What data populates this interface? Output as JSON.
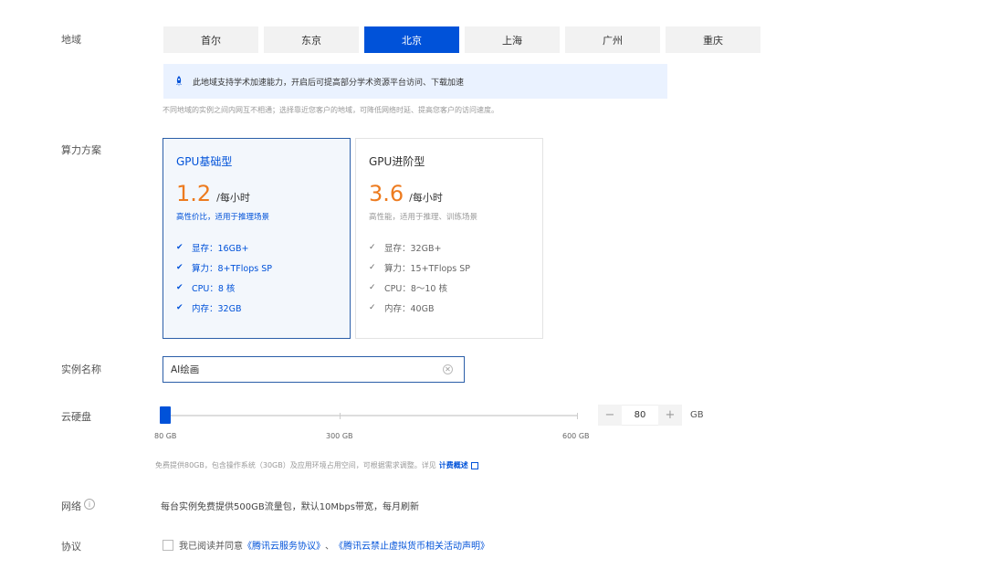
{
  "labels": {
    "region": "地域",
    "plan": "算力方案",
    "instance_name": "实例名称",
    "disk": "云硬盘",
    "network": "网络",
    "agreement": "协议"
  },
  "regions": [
    "首尔",
    "东京",
    "北京",
    "上海",
    "广州",
    "重庆"
  ],
  "selected_region": "北京",
  "notice": {
    "icon": "rocket-icon",
    "text": "此地域支持学术加速能力，开启后可提高部分学术资源平台访问、下载加速"
  },
  "region_hint": "不同地域的实例之间内网互不相通；选择靠近您客户的地域，可降低网络时延、提高您客户的访问速度。",
  "plans": [
    {
      "name": "GPU基础型",
      "price": "1.2",
      "unit": "/每小时",
      "desc": "高性价比，适用于推理场景",
      "specs": [
        "显存：16GB+",
        "算力：8+TFlops SP",
        "CPU：8 核",
        "内存：32GB"
      ],
      "selected": true
    },
    {
      "name": "GPU进阶型",
      "price": "3.6",
      "unit": "/每小时",
      "desc": "高性能，适用于推理、训练场景",
      "specs": [
        "显存：32GB+",
        "算力：15+TFlops SP",
        "CPU：8～10 核",
        "内存：40GB"
      ],
      "selected": false
    }
  ],
  "instance_name": {
    "value": "AI绘画"
  },
  "disk": {
    "min_label": "80 GB",
    "mid_label": "300 GB",
    "max_label": "600 GB",
    "value": "80",
    "unit": "GB",
    "minus": "−",
    "plus": "+",
    "hint": "免费提供80GB，包含操作系统（30GB）及应用环境占用空间，可根据需求调整。详见",
    "link": "计费概述"
  },
  "network": {
    "info_icon": "i",
    "text": "每台实例免费提供500GB流量包，默认10Mbps带宽，每月刷新"
  },
  "agreement": {
    "prefix": "我已阅读并同意",
    "link1": "《腾讯云服务协议》",
    "sep": "、",
    "link2": "《腾讯云禁止虚拟货币相关活动声明》"
  },
  "colors": {
    "accent": "#0052d9",
    "price": "#ed7b1f"
  }
}
